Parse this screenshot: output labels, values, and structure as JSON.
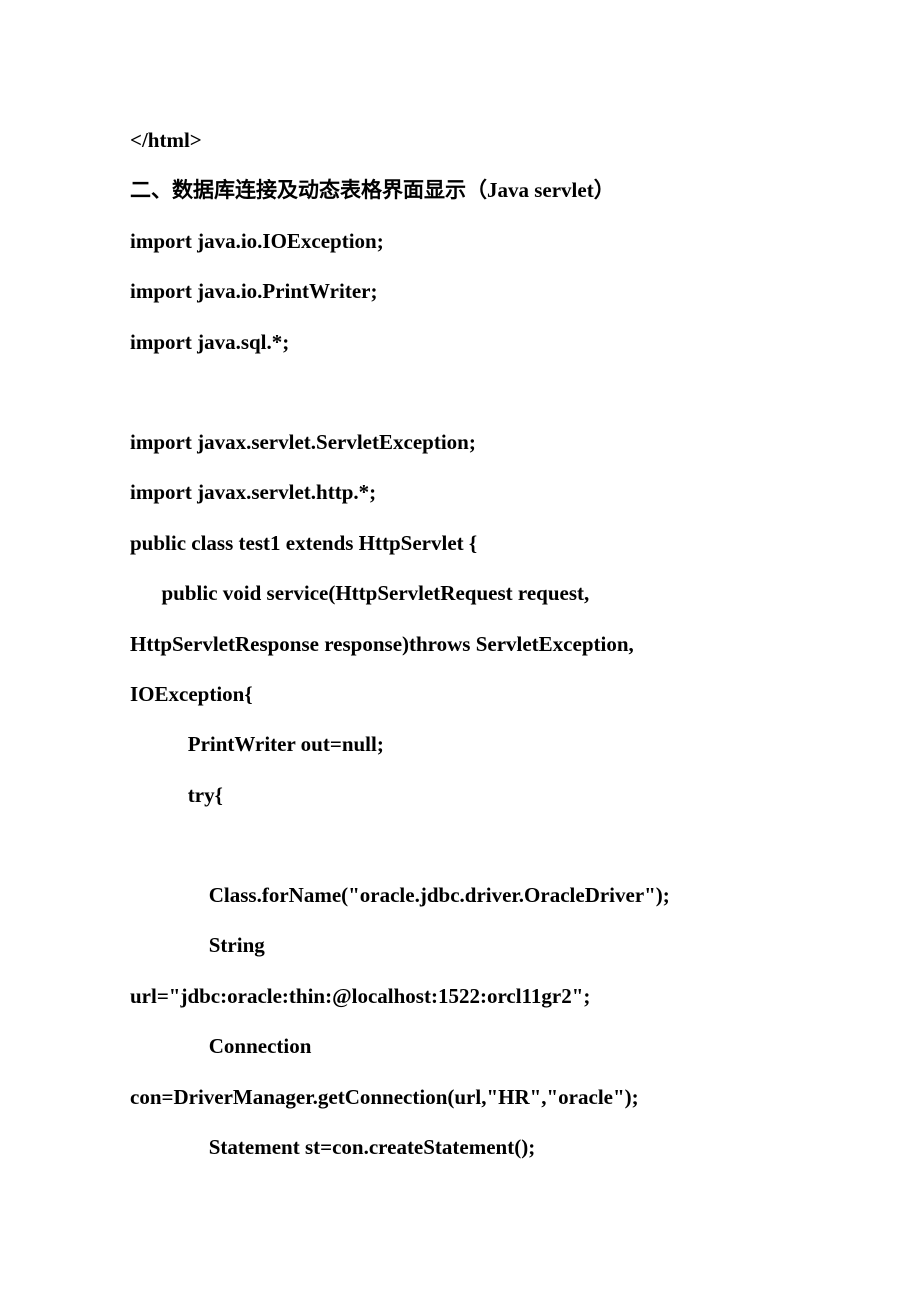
{
  "lines": [
    "</html>",
    "二、数据库连接及动态表格界面显示（Java servlet）",
    "import java.io.IOException;",
    "import java.io.PrintWriter;",
    "import java.sql.*;",
    "",
    "import javax.servlet.ServletException;",
    "import javax.servlet.http.*;",
    "public class test1 extends HttpServlet {",
    "      public void service(HttpServletRequest request,",
    "HttpServletResponse response)throws ServletException,",
    "IOException{",
    "           PrintWriter out=null;",
    "           try{",
    "",
    "               Class.forName(\"oracle.jdbc.driver.OracleDriver\");",
    "               String",
    "url=\"jdbc:oracle:thin:@localhost:1522:orcl11gr2\";",
    "               Connection",
    "con=DriverManager.getConnection(url,\"HR\",\"oracle\");",
    "               Statement st=con.createStatement();"
  ]
}
